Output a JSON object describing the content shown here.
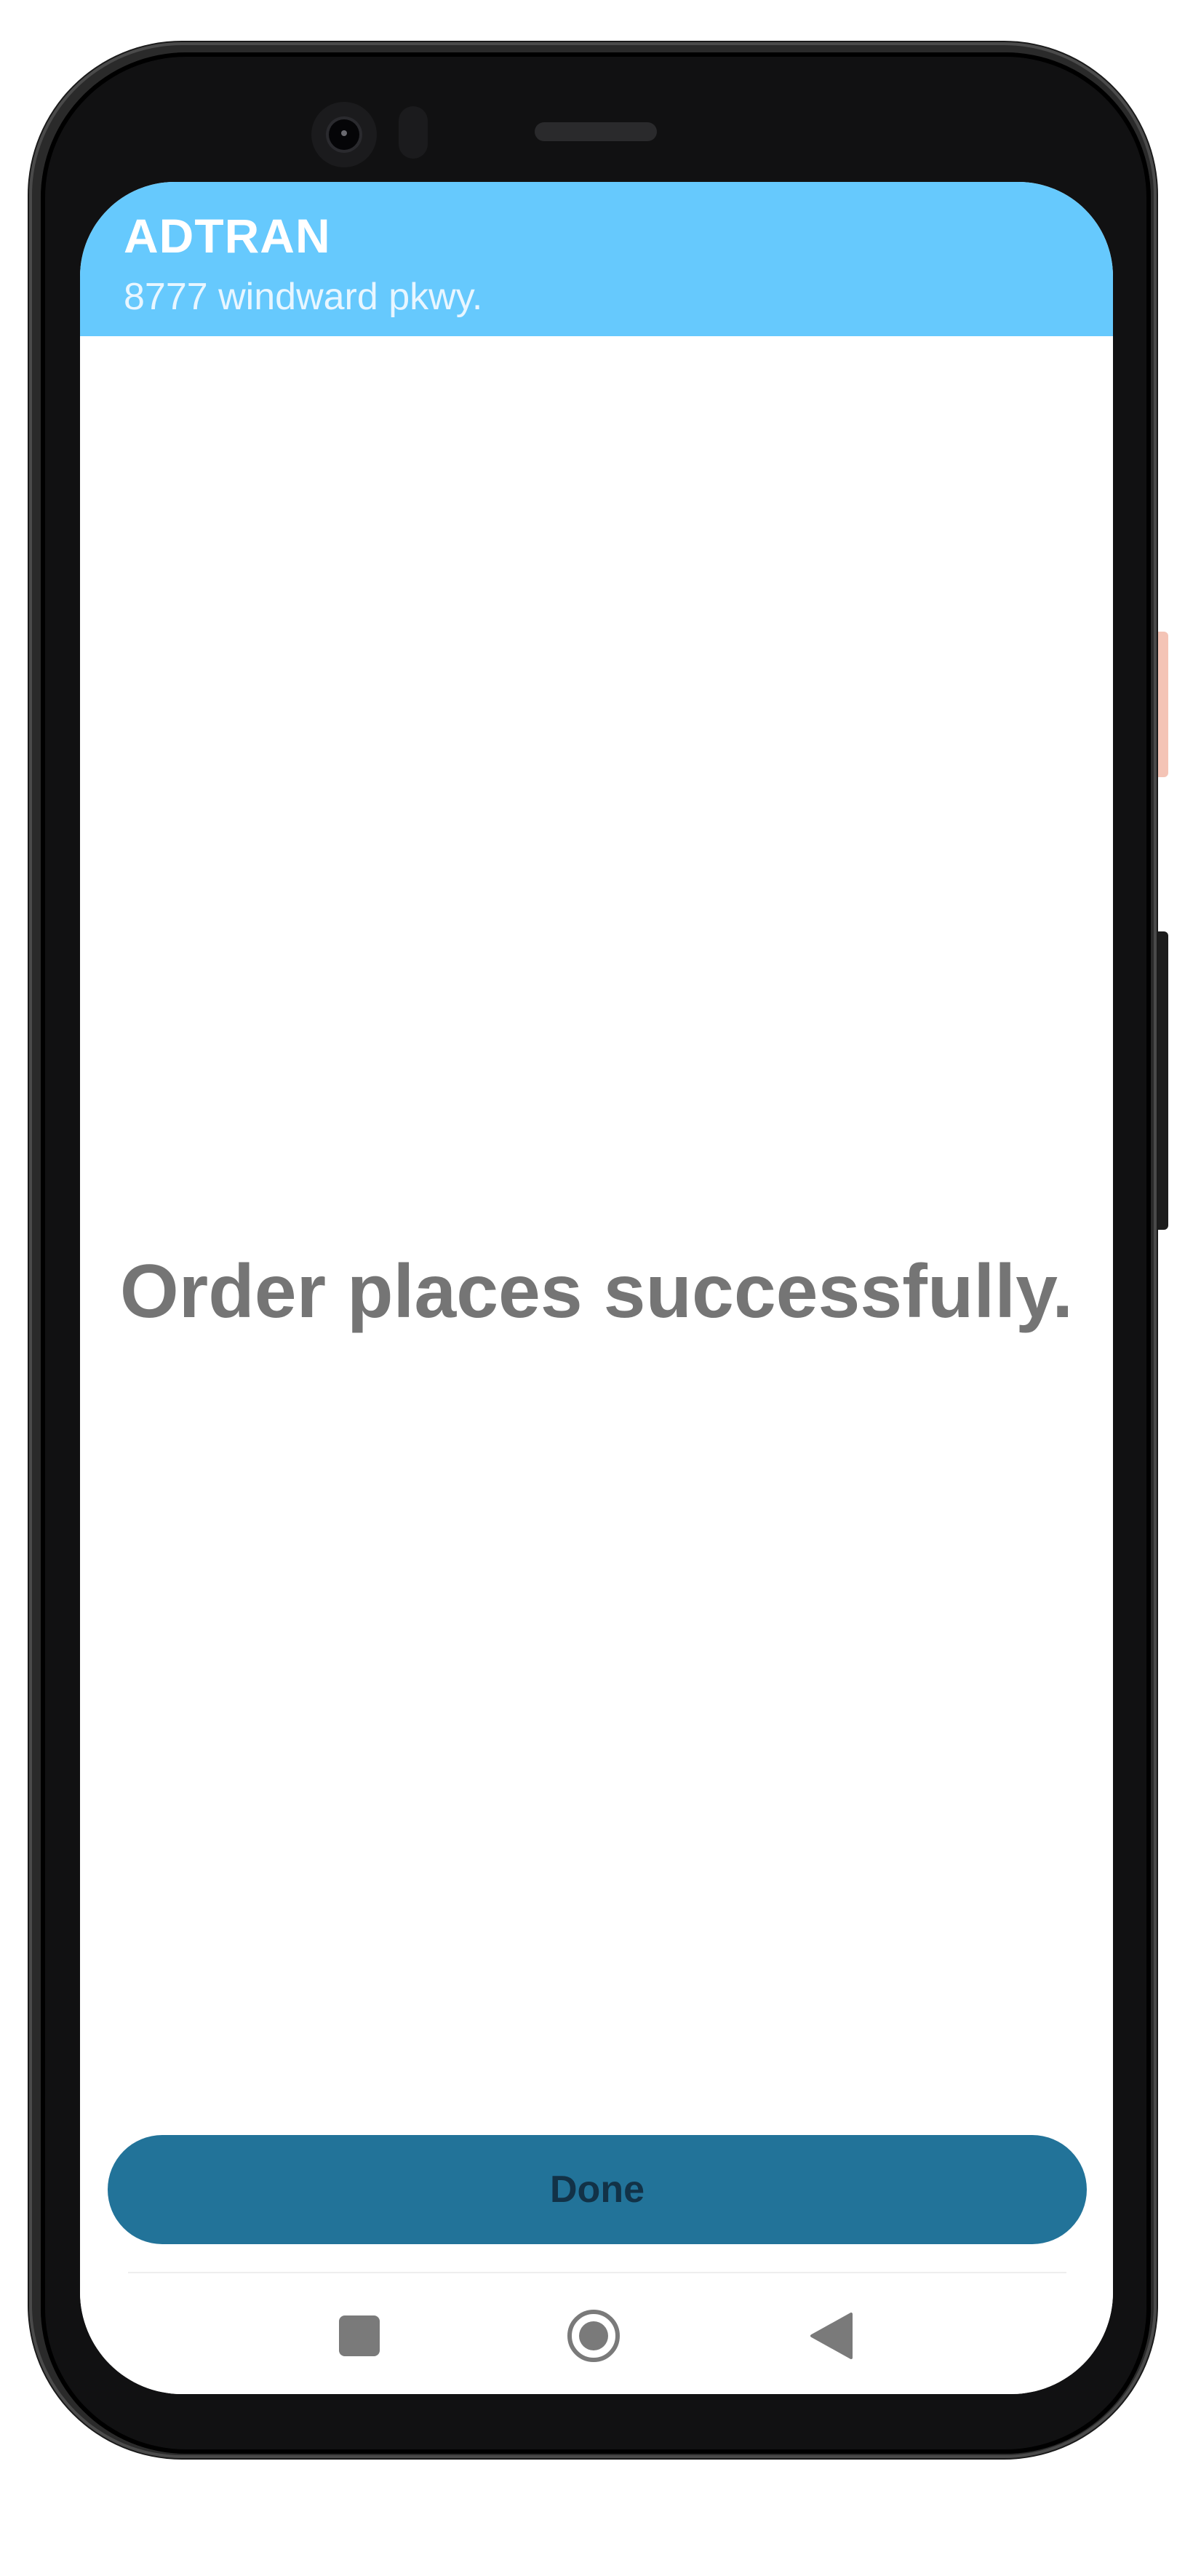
{
  "header": {
    "title": "ADTRAN",
    "subtitle": "8777 windward pkwy."
  },
  "main": {
    "message": "Order places successfully."
  },
  "actions": {
    "done_label": "Done"
  },
  "navigation": {
    "recents_icon": "square-recents-icon",
    "home_icon": "circle-home-icon",
    "back_icon": "triangle-back-icon"
  },
  "colors": {
    "header_background": "#66c9fd",
    "button_background": "#227399",
    "button_text": "#123247",
    "message_text": "#757575"
  }
}
